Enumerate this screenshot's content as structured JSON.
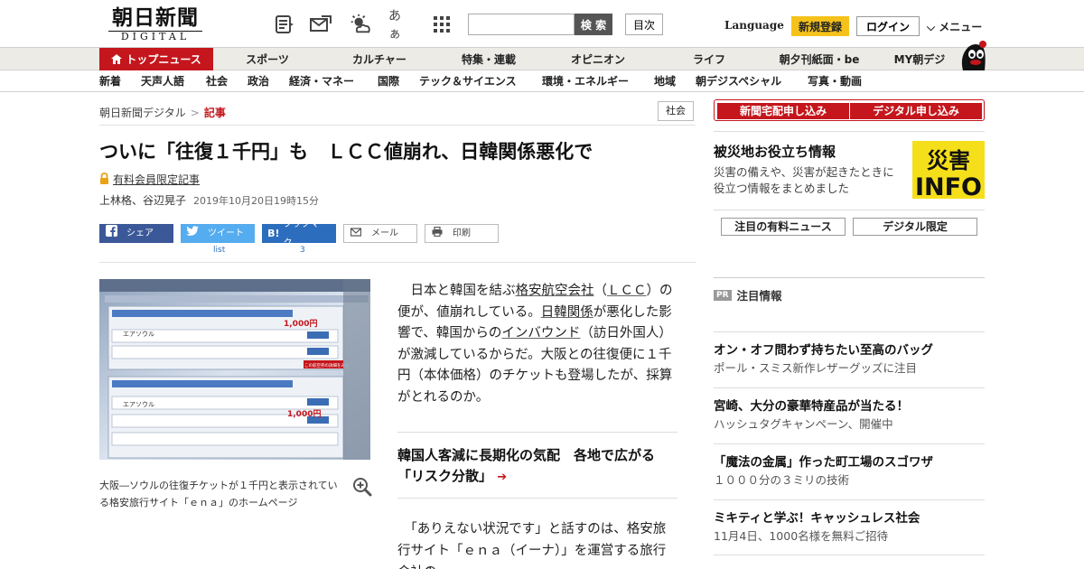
{
  "header": {
    "logo_main": "朝日新聞",
    "logo_sub": "DIGITAL",
    "font_size_label": "あぁ",
    "search_button": "検 索",
    "toc_button": "目次",
    "language": "Language",
    "signup": "新規登録",
    "login": "ログイン",
    "menu": "メニュー"
  },
  "nav_primary": [
    "トップニュース",
    "スポーツ",
    "カルチャー",
    "特集・連載",
    "オピニオン",
    "ライフ",
    "朝夕刊紙面・be",
    "MY朝デジ"
  ],
  "nav_secondary": [
    "新着",
    "天声人語",
    "社会",
    "政治",
    "経済・マネー",
    "国際",
    "テック＆サイエンス",
    "環境・エネルギー",
    "地域",
    "朝デジスペシャル",
    "写真・動画"
  ],
  "breadcrumb": {
    "home": "朝日新聞デジタル",
    "sep": ">",
    "current": "記事"
  },
  "category_tag": "社会",
  "article": {
    "headline": "ついに「往復１千円」も　ＬＣＣ値崩れ、日韓関係悪化で",
    "members_only": "有料会員限定記事",
    "authors": "上林格、谷辺晃子",
    "date": "2019年10月20日19時15分",
    "caption": "大阪―ソウルの往復チケットが１千円と表示されている格安旅行サイト「ｅｎａ」のホームページ",
    "p1_a": "日本と韓国を結ぶ",
    "p1_link1": "格安航空会社",
    "p1_b": "（",
    "p1_link2": "ＬＣＣ",
    "p1_c": "）の便が、値崩れしている。",
    "p1_link3": "日韓関係",
    "p1_d": "が悪化した影響で、韓国からの",
    "p1_link4": "インバウンド",
    "p1_e": "（訪日外国人）が激減しているからだ。大阪との往復便に１千円（本体価格）のチケットも登場したが、採算がとれるのか。",
    "related_link": "韓国人客減に長期化の気配　各地で広がる「リスク分散」",
    "related_arrow": "➔",
    "p2": "「ありえない状況です」と話すのは、格安旅行サイト「ｅｎａ（イーナ）」を運営する旅行会社の"
  },
  "share": {
    "facebook": "シェア",
    "twitter": "ツイート",
    "twitter_count": "list",
    "hatena": "ブックマーク",
    "hatena_count": "3",
    "mail": "メール",
    "print": "印刷"
  },
  "photo_screen": {
    "price1": "1,000円",
    "price2": "1,000円",
    "airline": "エアソウル",
    "detail_button": "この航空券の詳細をみる"
  },
  "sidebar": {
    "subscribe_paper": "新聞宅配申し込み",
    "subscribe_digital": "デジタル申し込み",
    "disaster_title": "被災地お役立ち情報",
    "disaster_desc": "災害の備えや、災害が起きたときに役立つ情報をまとめました",
    "disaster_logo_top": "災害",
    "disaster_logo_bottom": "INFO",
    "tab_paid_news": "注目の有料ニュース",
    "tab_digital_only": "デジタル限定",
    "pr_badge": "PR",
    "pr_heading": "注目情報",
    "pr_items": [
      {
        "title": "オン・オフ問わず持ちたい至高のバッグ",
        "sub": "ポール・スミス新作レザーグッズに注目"
      },
      {
        "title": "宮崎、大分の豪華特産品が当たる！",
        "sub": "ハッシュタグキャンペーン、開催中"
      },
      {
        "title": "「魔法の金属」作った町工場のスゴワザ",
        "sub": "１０００分の３ミリの技術"
      },
      {
        "title": "ミキティと学ぶ！キャッシュレス社会",
        "sub": "11月4日、1000名様を無料ご招待"
      }
    ]
  },
  "colors": {
    "brand_red": "#c4161c",
    "signup_yellow": "#f5c21b",
    "facebook": "#3b5998",
    "twitter": "#55acee",
    "hatena": "#2c6ebd"
  }
}
